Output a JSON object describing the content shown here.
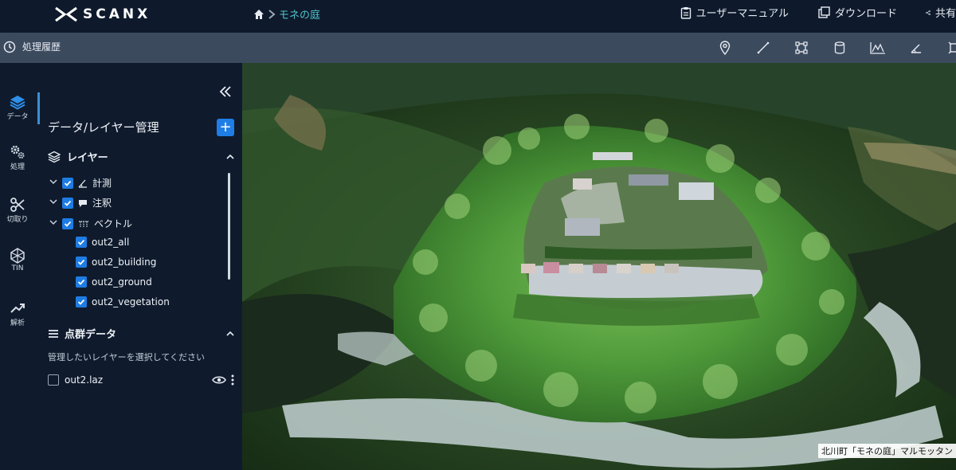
{
  "header": {
    "brand": "SCANX",
    "breadcrumb_current": "モネの庭",
    "actions": [
      {
        "label": "ユーザーマニュアル",
        "icon": "clipboard-icon"
      },
      {
        "label": "ダウンロード",
        "icon": "download-icon"
      },
      {
        "label": "共有",
        "icon": "share-icon"
      }
    ]
  },
  "toolbar": {
    "history_label": "処理履歴",
    "tools": [
      "pin-icon",
      "line-measure-icon",
      "area-measure-icon",
      "volume-icon",
      "profile-icon",
      "angle-icon",
      "more-icon"
    ]
  },
  "rail": {
    "items": [
      {
        "label": "データ",
        "icon": "layers-icon"
      },
      {
        "label": "処理",
        "icon": "gears-icon"
      },
      {
        "label": "切取り",
        "icon": "scissors-icon"
      },
      {
        "label": "TIN",
        "icon": "tin-mesh-icon"
      },
      {
        "label": "解析",
        "icon": "trend-icon"
      }
    ]
  },
  "panel": {
    "title": "データ/レイヤー管理",
    "add_symbol": "+",
    "layers_section": {
      "title": "レイヤー",
      "groups": [
        {
          "label": "計測",
          "icon": "measure-icon",
          "checked": true
        },
        {
          "label": "注釈",
          "icon": "comment-icon",
          "checked": true
        },
        {
          "label": "ベクトル",
          "icon": "vector-icon",
          "checked": true
        }
      ],
      "children": [
        {
          "label": "out2_all",
          "checked": true
        },
        {
          "label": "out2_building",
          "checked": true
        },
        {
          "label": "out2_ground",
          "checked": true
        },
        {
          "label": "out2_vegetation",
          "checked": true
        }
      ]
    },
    "pointcloud_section": {
      "title": "点群データ",
      "hint": "管理したいレイヤーを選択してください",
      "files": [
        {
          "name": "out2.laz",
          "checked": false
        }
      ]
    }
  },
  "viewport": {
    "caption": "北川町「モネの庭」マルモッタン"
  },
  "colors": {
    "header_bg": "#0e1a2c",
    "toolbar_bg": "#3c4a5e",
    "accent_blue": "#1e7ce3",
    "breadcrumb_teal": "#4fc3c9"
  }
}
